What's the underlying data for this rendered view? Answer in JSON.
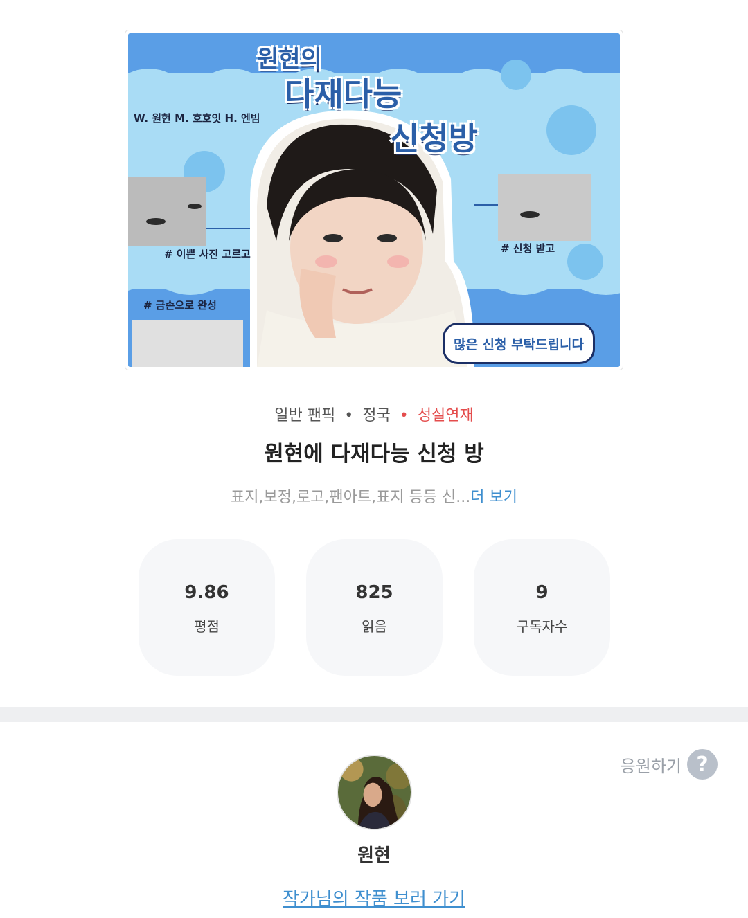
{
  "cover": {
    "title_line1": "원현의",
    "title_line2": "다재다능",
    "title_line3": "신청방",
    "credit": "W. 원현 M. 호호잇 H. 엔빔",
    "tag1": "# 이쁜 사진 고르고",
    "tag2": "# 신청 받고",
    "tag3": "# 금손으로 완성",
    "bubble": "많은 신청 부탁드립니다"
  },
  "meta": {
    "genre": "일반 팬픽",
    "character": "정국",
    "status": "성실연재",
    "separator": "•"
  },
  "title": "원현에 다재다능 신청 방",
  "description": {
    "text": "표지,보정,로고,팬아트,표지 등등 신...",
    "more_label": "더 보기"
  },
  "stats": [
    {
      "value": "9.86",
      "label": "평점"
    },
    {
      "value": "825",
      "label": "읽음"
    },
    {
      "value": "9",
      "label": "구독자수"
    }
  ],
  "support": {
    "label": "응원하기",
    "icon": "question-mark-icon",
    "icon_glyph": "?"
  },
  "author": {
    "name": "원현",
    "link_label": "작가님의 작품 보러 가기"
  },
  "colors": {
    "accent_blue": "#3f8fcf",
    "status_red": "#e44d4d",
    "stat_bg": "#f6f7f9",
    "divider": "#eeeff1"
  }
}
